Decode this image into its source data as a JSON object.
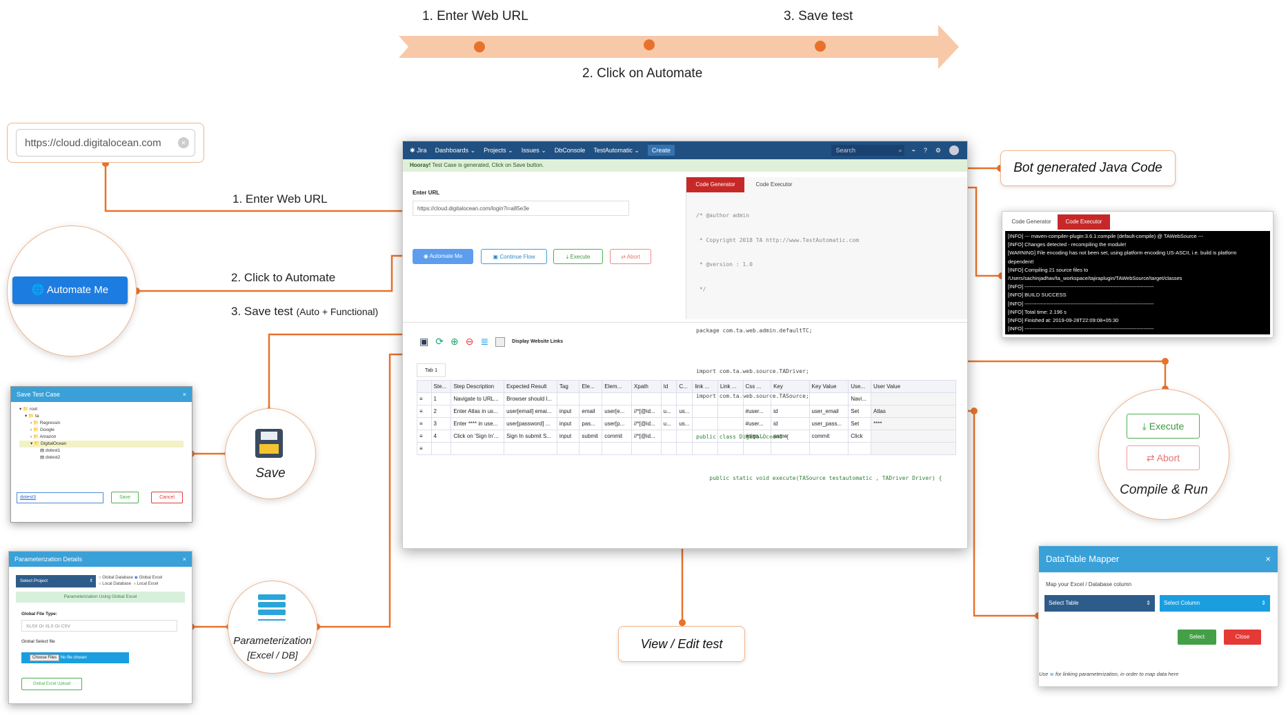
{
  "timeline": {
    "step1": "1. Enter Web URL",
    "step2": "2. Click on Automate",
    "step3": "3. Save test"
  },
  "left": {
    "url_value": "https://cloud.digitalocean.com",
    "wire1": "1. Enter Web URL",
    "automate_button": "Automate Me",
    "wire2": "2. Click to Automate",
    "wire3_main": "3. Save test",
    "wire3_sub": "(Auto + Functional)"
  },
  "save_dialog": {
    "title": "Save Test Case",
    "tree": [
      "root",
      "ta",
      "Regressin",
      "Google",
      "Amazon",
      "DigitalOcean",
      "dotest1",
      "dotest2"
    ],
    "input": "dotest3",
    "save": "Save",
    "cancel": "Cancel",
    "bubble_label": "Save"
  },
  "param_dialog": {
    "title": "Parameterization Details",
    "select_project": "Select Project",
    "opt1": "Global Database",
    "opt2": "Global Excel",
    "opt3": "Local Database",
    "opt4": "Local Excel",
    "banner": "Parameterization Using Global Excel",
    "file_type_label": "Global File Type:",
    "file_type_placeholder": "XLSX Or XLS Or CSV",
    "select_file_label": "Global Select file",
    "choose_files": "Choose Files",
    "no_file": "No file chosen",
    "upload": "Global Excel Upload",
    "bubble_label1": "Parameterization",
    "bubble_label2": "[Excel / DB]"
  },
  "app": {
    "nav": [
      "Jira",
      "Dashboards",
      "Projects",
      "Issues",
      "DbConsole",
      "TestAutomatic"
    ],
    "create": "Create",
    "search": "Search",
    "hooray_strong": "Hooray!",
    "hooray_text": "Test Case is generated, Click on Save button.",
    "enter_url_label": "Enter URL",
    "url": "https://cloud.digitalocean.com/login?i=a85e3e",
    "btn_automate": "Automate Me",
    "btn_continue": "Continue Flow",
    "btn_execute": "Execute",
    "btn_abort": "Abort",
    "tab_codegen": "Code Generator",
    "tab_codeexec": "Code Executor",
    "code": [
      "/* @author admin",
      " * Copyright 2018 TA http://www.TestAutomatic.com",
      " * @version : 1.0",
      " */",
      "",
      "package com.ta.web.admin.defaultTC;",
      "",
      "import com.ta.web.source.TADriver;",
      "import com.ta.web.source.TASource;",
      "",
      "public class DigitalOcean1 {",
      "",
      "    public static void execute(TASource testautomatic , TADriver Driver) {"
    ],
    "display_links": "Display Website Links",
    "tab1": "Tab 1",
    "columns": [
      "",
      "Ste...",
      "Step Description",
      "Expected Result",
      "Tag",
      "Ele...",
      "Elem...",
      "Xpath",
      "Id",
      "C...",
      "link ...",
      "Link ...",
      "Css ...",
      "Key",
      "Key Value",
      "Use...",
      "User Value"
    ],
    "rows": [
      [
        "≡",
        "1",
        "Navigate to URL...",
        "Browser should l...",
        "",
        "",
        "",
        "",
        "",
        "",
        "",
        "",
        "",
        "",
        "",
        "Navi...",
        ""
      ],
      [
        "≡",
        "2",
        "Enter Atlas in us...",
        "user[email] emai...",
        "input",
        "email",
        "user[e...",
        "//*[@id...",
        "u...",
        "us...",
        "",
        "",
        "#user...",
        "id",
        "user_email",
        "Set",
        "Atlas"
      ],
      [
        "≡",
        "3",
        "Enter **** in use...",
        "user[password] ...",
        "input",
        "pas...",
        "user[p...",
        "//*[@id...",
        "u...",
        "us...",
        "",
        "",
        "#user...",
        "id",
        "user_pass...",
        "Set",
        "****"
      ],
      [
        "≡",
        "4",
        "Click on 'Sign In'...",
        "Sign In submit S...",
        "input",
        "submit",
        "commit",
        "//*[@id...",
        "",
        "",
        "",
        "",
        "#sign...",
        "name",
        "commit",
        "Click",
        ""
      ],
      [
        "≡",
        "",
        "",
        "",
        "",
        "",
        "",
        "",
        "",
        "",
        "",
        "",
        "",
        "",
        "",
        "",
        ""
      ]
    ]
  },
  "right": {
    "bot_code": "Bot generated Java Code",
    "console_tab1": "Code Generator",
    "console_tab2": "Code Executor",
    "console_lines": [
      "[INFO] --- maven-compiler-plugin:3.6.1:compile (default-compile) @ TAWebSource ---",
      "[INFO] Changes detected - recompiling the module!",
      "[WARNING] File encoding has not been set, using platform encoding US-ASCII, i.e. build is platform",
      "dependent!",
      "[INFO] Compiling 21 source files to",
      "/Users/sachinjadhav/ta_workspace/tajiraplugin/TAWebSource/target/classes",
      "[INFO] ---------------------------------------------------------------------------",
      "[INFO] BUILD SUCCESS",
      "[INFO] ---------------------------------------------------------------------------",
      "[INFO] Total time:  2.196 s",
      "[INFO] Finished at: 2019-09-28T22:09:08+05:30",
      "[INFO] ---------------------------------------------------------------------------"
    ],
    "execute": "Execute",
    "abort": "Abort",
    "compile_run": "Compile & Run",
    "mapper_title": "DataTable Mapper",
    "mapper_sub": "Map your Excel / Database column",
    "select_table": "Select Table",
    "select_column": "Select Column",
    "select_btn": "Select",
    "close_btn": "Close",
    "mapper_foot_use": "Use",
    "mapper_foot_text": "for linking parameterization, in order to map data here"
  },
  "view_edit": "View / Edit test",
  "colors": {
    "accent": "#e8722c",
    "arrow": "#f8c9a8",
    "jira": "#205081",
    "blue": "#3aa0d8"
  }
}
